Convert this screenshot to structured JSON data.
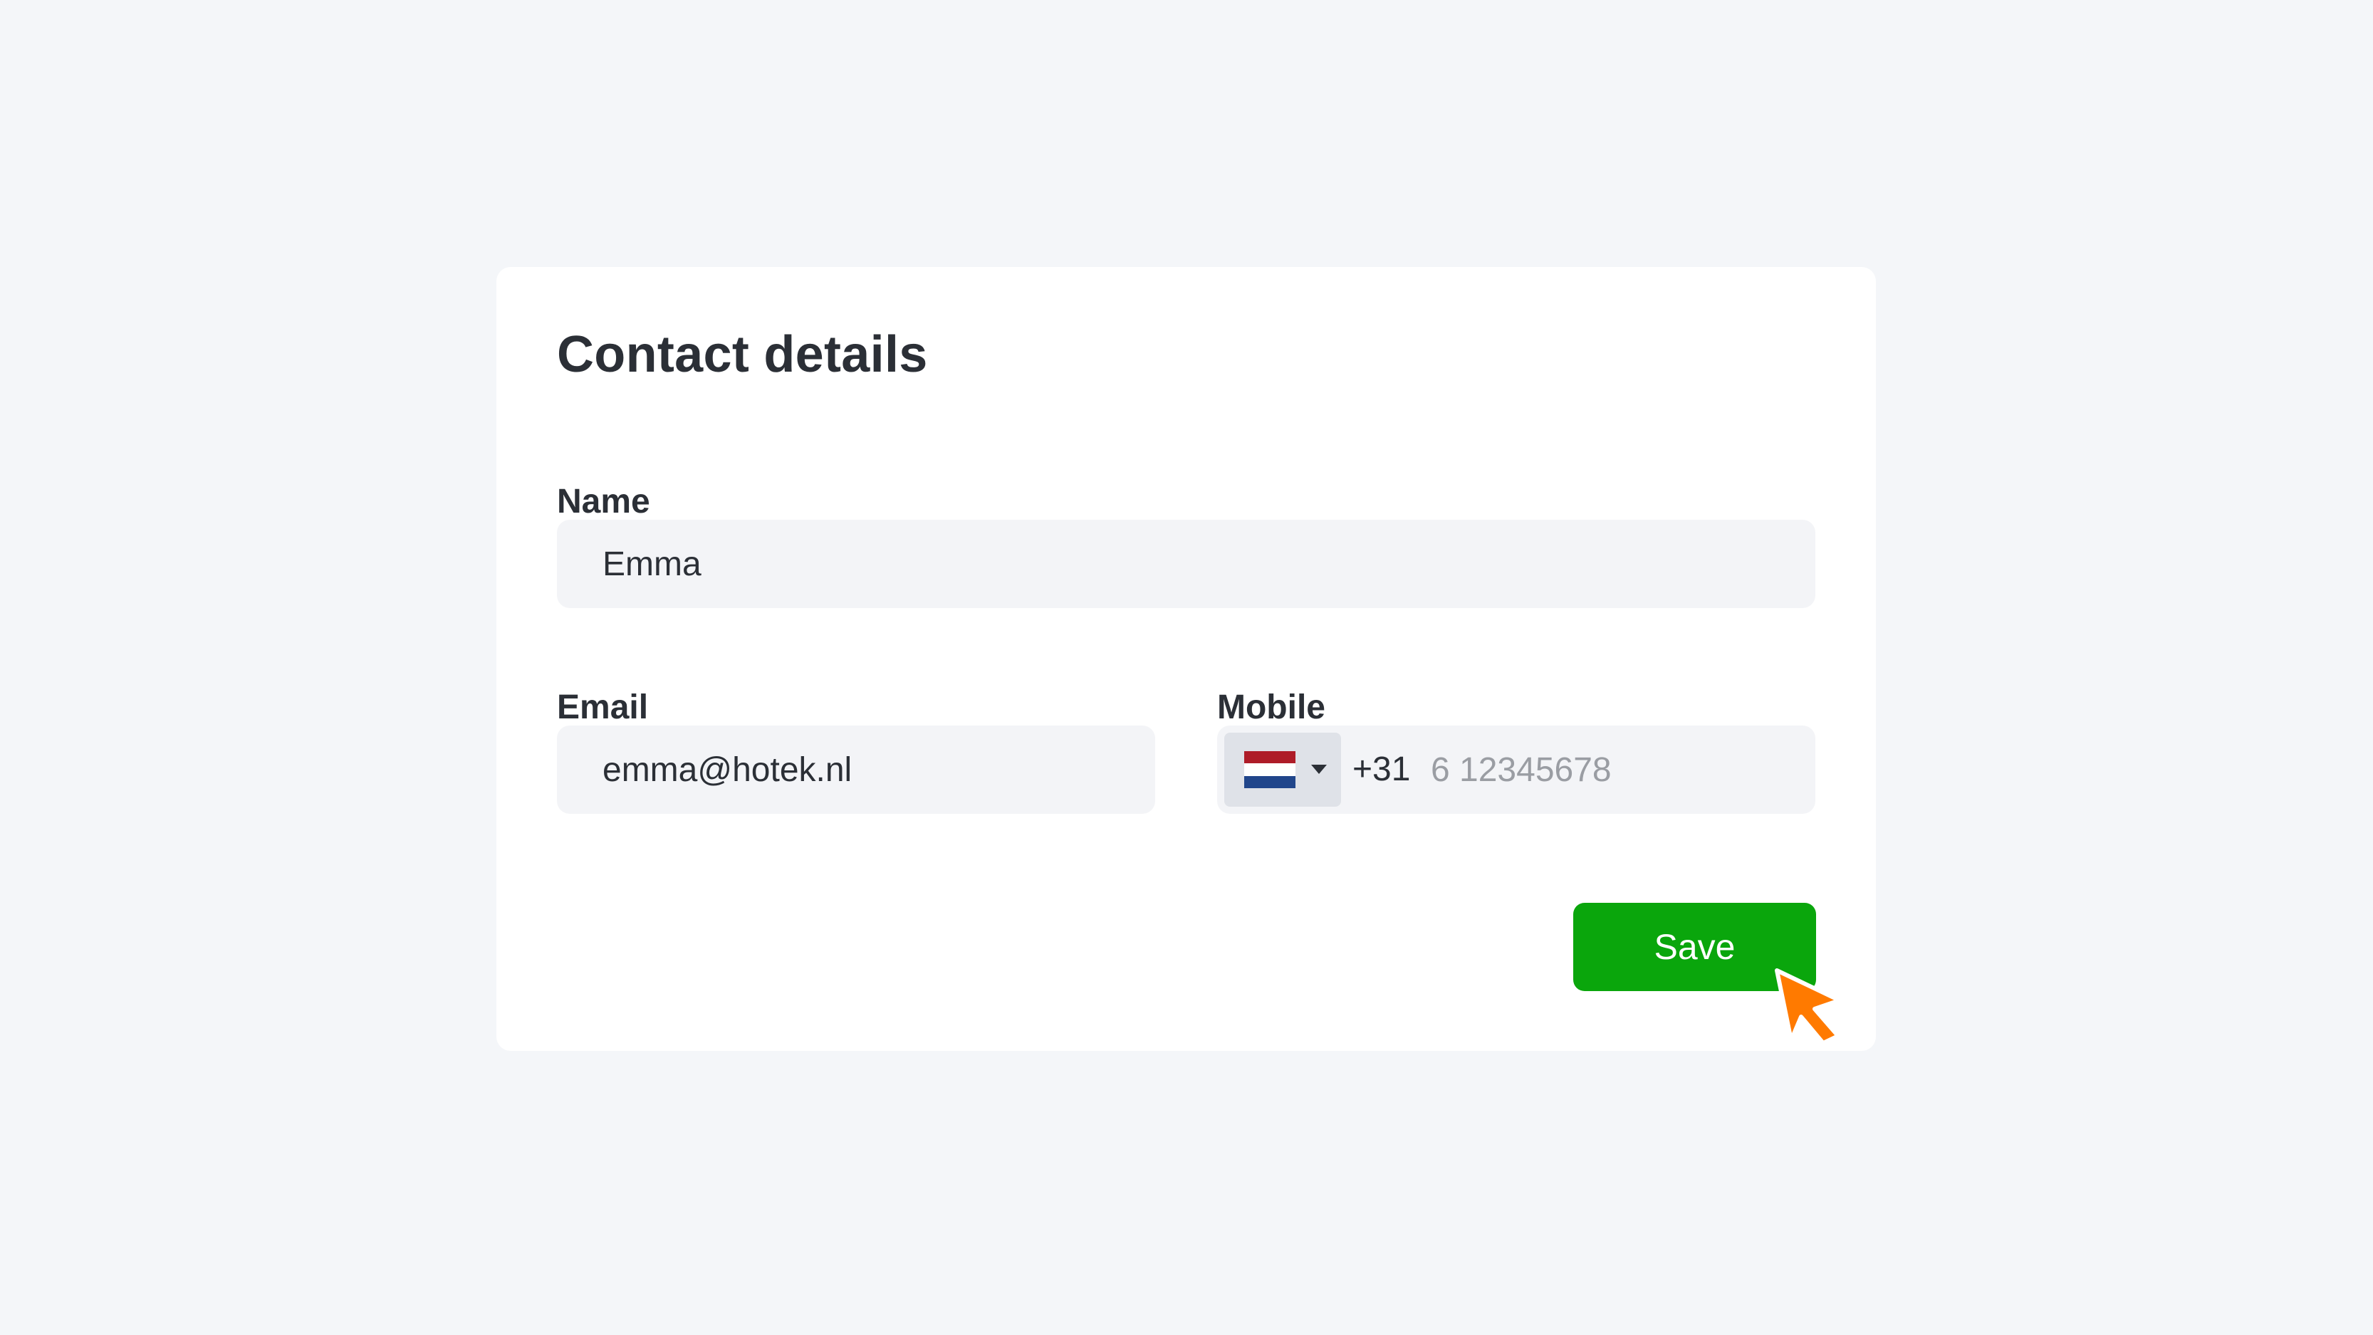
{
  "form": {
    "title": "Contact details",
    "name": {
      "label": "Name",
      "value": "Emma"
    },
    "email": {
      "label": "Email",
      "value": "emma@hotek.nl"
    },
    "mobile": {
      "label": "Mobile",
      "country_code": "+31",
      "country_flag": "netherlands-flag",
      "placeholder": "6 12345678",
      "value": ""
    },
    "save_label": "Save"
  },
  "colors": {
    "background": "#f4f6f9",
    "card": "#ffffff",
    "field": "#f3f4f7",
    "save_button": "#0aa60c",
    "cursor": "#ff7a00"
  },
  "icons": {
    "cursor": "mouse-pointer-icon",
    "dropdown": "caret-down-icon"
  }
}
